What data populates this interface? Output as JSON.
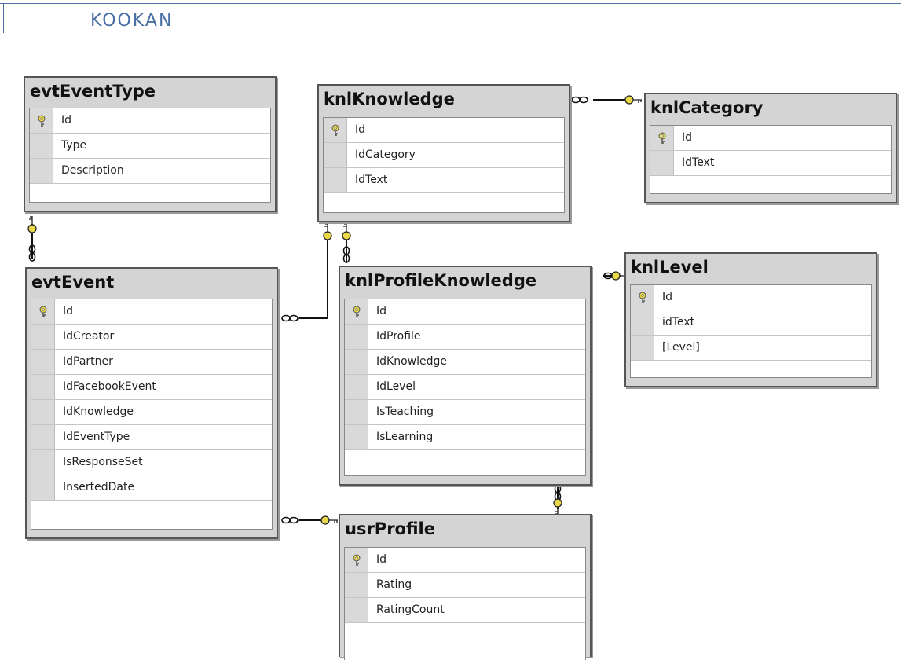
{
  "document": {
    "title": "KOOKAN"
  },
  "colors": {
    "accent": "#4a6fa5",
    "key": "#e8d84a",
    "line": "#111111"
  },
  "tables": [
    {
      "id": "evtEventType",
      "name": "evtEventType",
      "columns": [
        {
          "name": "Id",
          "pk": true
        },
        {
          "name": "Type",
          "pk": false
        },
        {
          "name": "Description",
          "pk": false
        }
      ]
    },
    {
      "id": "knlKnowledge",
      "name": "knlKnowledge",
      "columns": [
        {
          "name": "Id",
          "pk": true
        },
        {
          "name": "IdCategory",
          "pk": false
        },
        {
          "name": "IdText",
          "pk": false
        }
      ]
    },
    {
      "id": "knlCategory",
      "name": "knlCategory",
      "columns": [
        {
          "name": "Id",
          "pk": true
        },
        {
          "name": "IdText",
          "pk": false
        }
      ]
    },
    {
      "id": "evtEvent",
      "name": "evtEvent",
      "columns": [
        {
          "name": "Id",
          "pk": true
        },
        {
          "name": "IdCreator",
          "pk": false
        },
        {
          "name": "IdPartner",
          "pk": false
        },
        {
          "name": "IdFacebookEvent",
          "pk": false
        },
        {
          "name": "IdKnowledge",
          "pk": false
        },
        {
          "name": "IdEventType",
          "pk": false
        },
        {
          "name": "IsResponseSet",
          "pk": false
        },
        {
          "name": "InsertedDate",
          "pk": false
        }
      ]
    },
    {
      "id": "knlProfileKnowledge",
      "name": "knlProfileKnowledge",
      "columns": [
        {
          "name": "Id",
          "pk": true
        },
        {
          "name": "IdProfile",
          "pk": false
        },
        {
          "name": "IdKnowledge",
          "pk": false
        },
        {
          "name": "IdLevel",
          "pk": false
        },
        {
          "name": "IsTeaching",
          "pk": false
        },
        {
          "name": "IsLearning",
          "pk": false
        }
      ]
    },
    {
      "id": "knlLevel",
      "name": "knlLevel",
      "columns": [
        {
          "name": "Id",
          "pk": true
        },
        {
          "name": "idText",
          "pk": false
        },
        {
          "name": "[Level]",
          "pk": false
        }
      ]
    },
    {
      "id": "usrProfile",
      "name": "usrProfile",
      "columns": [
        {
          "name": "Id",
          "pk": true
        },
        {
          "name": "Rating",
          "pk": false
        },
        {
          "name": "RatingCount",
          "pk": false
        }
      ]
    }
  ],
  "relationships": [
    {
      "from": "knlKnowledge",
      "to": "knlCategory",
      "many_side": "knlKnowledge",
      "one_side": "knlCategory"
    },
    {
      "from": "evtEvent",
      "to": "evtEventType",
      "many_side": "evtEvent",
      "one_side": "evtEventType"
    },
    {
      "from": "evtEvent",
      "to": "knlKnowledge",
      "many_side": "evtEvent",
      "one_side": "knlKnowledge"
    },
    {
      "from": "knlProfileKnowledge",
      "to": "knlKnowledge",
      "many_side": "knlProfileKnowledge",
      "one_side": "knlKnowledge"
    },
    {
      "from": "knlProfileKnowledge",
      "to": "knlLevel",
      "many_side": "knlProfileKnowledge",
      "one_side": "knlLevel"
    },
    {
      "from": "knlProfileKnowledge",
      "to": "usrProfile",
      "many_side": "knlProfileKnowledge",
      "one_side": "usrProfile"
    },
    {
      "from": "evtEvent",
      "to": "usrProfile",
      "many_side": "evtEvent",
      "one_side": "usrProfile"
    }
  ]
}
